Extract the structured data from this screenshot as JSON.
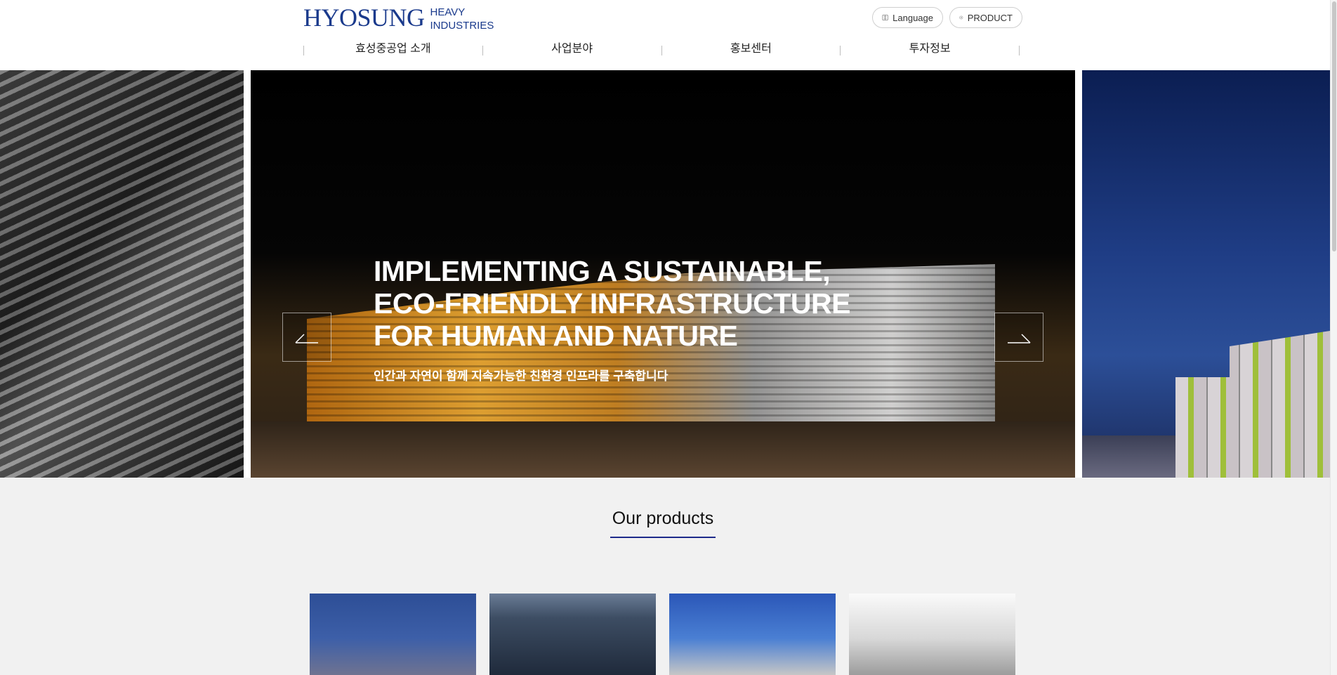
{
  "brand": {
    "name": "HYOSUNG",
    "sub_line1": "HEAVY",
    "sub_line2": "INDUSTRIES",
    "color": "#1a3a8c"
  },
  "utility": {
    "language_label": "Language",
    "product_label": "PRODUCT"
  },
  "nav": {
    "items": [
      "효성중공업 소개",
      "사업분야",
      "홍보센터",
      "투자정보"
    ]
  },
  "hero": {
    "title_lines": [
      "IMPLEMENTING A SUSTAINABLE,",
      "ECO-FRIENDLY INFRASTRUCTURE",
      "FOR HUMAN AND NATURE"
    ],
    "subtitle": "인간과 자연이 함께 지속가능한 친환경 인프라를 구축합니다",
    "slide_count": 3,
    "active_slide": 1
  },
  "products": {
    "title": "Our products",
    "accent_color": "#1d2a8a"
  }
}
